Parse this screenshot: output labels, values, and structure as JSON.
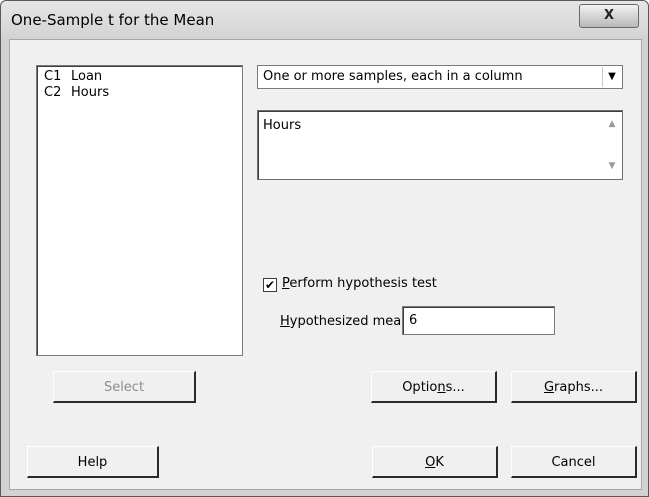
{
  "window": {
    "title": "One-Sample t for the Mean",
    "close_glyph": "X"
  },
  "variables": [
    {
      "col": "C1",
      "name": "Loan"
    },
    {
      "col": "C2",
      "name": "Hours"
    }
  ],
  "data_mode": {
    "selected": "One or more samples, each in a column"
  },
  "samples_text": "Hours",
  "hypothesis": {
    "perform_checked": true,
    "perform_label_accel": "P",
    "perform_label_rest": "erform hypothesis test",
    "mean_label_accel": "H",
    "mean_label_rest": "ypothesized mean:",
    "mean_value": "6"
  },
  "buttons": {
    "select": "Select",
    "options_pre": "Optio",
    "options_accel": "n",
    "options_post": "s...",
    "graphs_accel": "G",
    "graphs_post": "raphs...",
    "help": "Help",
    "ok_accel": "O",
    "ok_post": "K",
    "cancel": "Cancel"
  },
  "icons": {
    "close": "close-icon",
    "dropdown": "chevron-down-icon",
    "scroll_up": "scroll-up-icon",
    "scroll_down": "scroll-down-icon",
    "check": "check-icon"
  }
}
